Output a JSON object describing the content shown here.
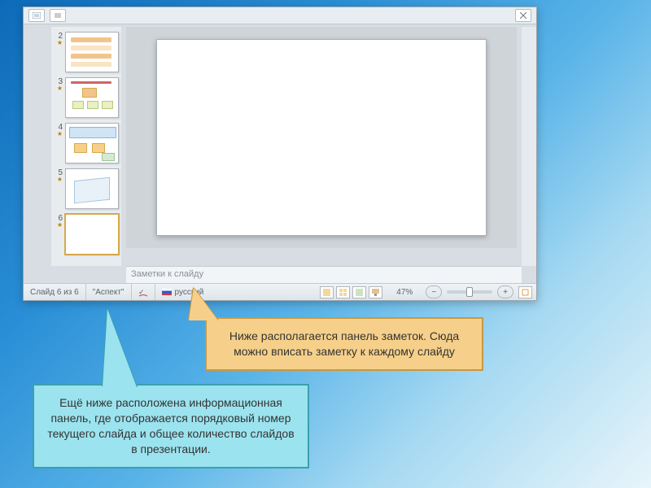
{
  "thumbs": [
    {
      "num": "2"
    },
    {
      "num": "3"
    },
    {
      "num": "4"
    },
    {
      "num": "5"
    },
    {
      "num": "6",
      "selected": true
    }
  ],
  "notes_placeholder": "Заметки к слайду",
  "status": {
    "slide_counter": "Слайд 6 из 6",
    "theme": "\"Аспект\"",
    "language": "русский",
    "zoom": "47%"
  },
  "callouts": {
    "orange": "Ниже располагается панель заметок. Сюда можно вписать заметку к каждому слайду",
    "cyan": "Ещё ниже расположена информационная панель, где отображается порядковый номер текущего слайда и общее количество слайдов в презентации."
  }
}
